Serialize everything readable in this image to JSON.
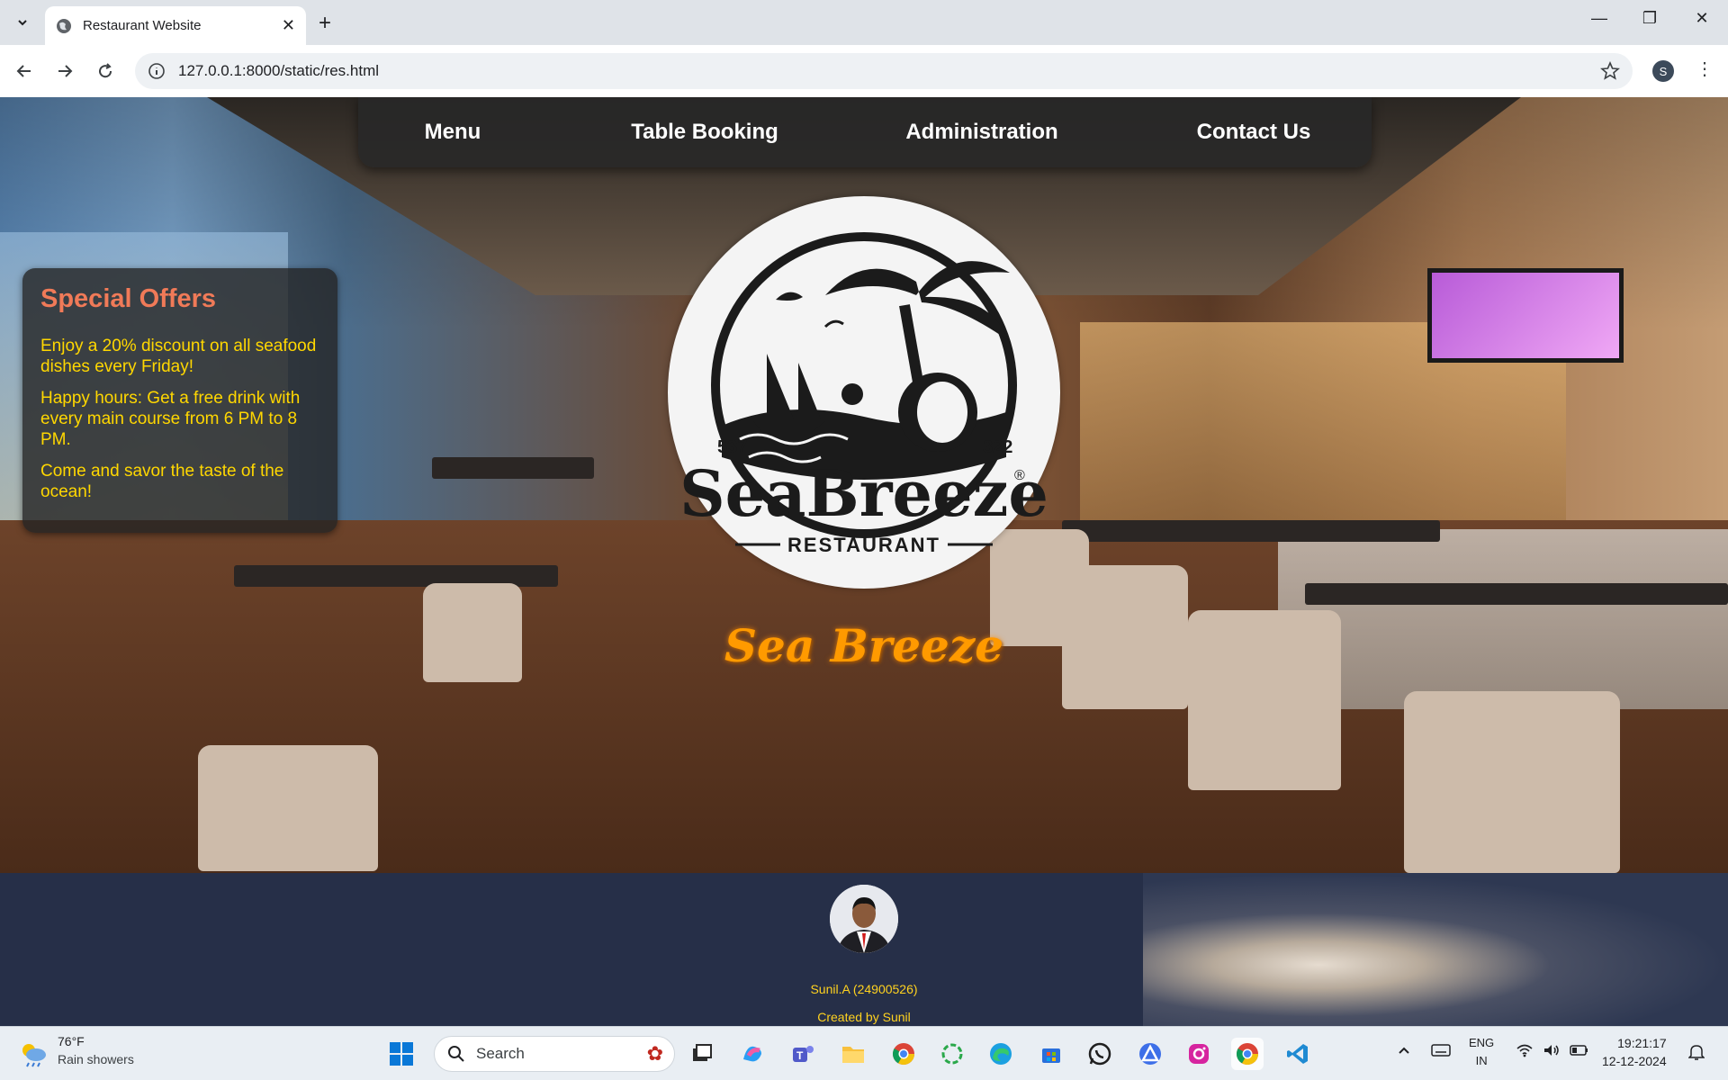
{
  "browser": {
    "tab_title": "Restaurant Website",
    "url": "127.0.0.1:8000/static/res.html",
    "profile_initial": "S"
  },
  "nav": {
    "items": [
      {
        "label": "Menu"
      },
      {
        "label": "Table Booking"
      },
      {
        "label": "Administration"
      },
      {
        "label": "Contact Us"
      }
    ]
  },
  "logo": {
    "left_number": "537",
    "right_number": "322",
    "name": "SeaBreeze",
    "registered": "®",
    "subtitle": "RESTAURANT"
  },
  "brand_script": "Sea Breeze",
  "offers": {
    "title": "Special Offers",
    "items": [
      "Enjoy a 20% discount on all seafood dishes every Friday!",
      "Happy hours: Get a free drink with every main course from 6 PM to 8 PM.",
      "Come and savor the taste of the ocean!"
    ]
  },
  "footer": {
    "author": "Sunil.A (24900526)",
    "credit": "Created by Sunil"
  },
  "taskbar": {
    "weather_temp": "76°F",
    "weather_desc": "Rain showers",
    "search_placeholder": "Search",
    "lang_top": "ENG",
    "lang_bottom": "IN",
    "time": "19:21:17",
    "date": "12-12-2024"
  },
  "colors": {
    "offer_title": "#f07a58",
    "offer_text": "#ffd700",
    "footer_bg": "#262f48",
    "footer_text": "#ffd21f",
    "script_orange": "#ff9a00"
  }
}
